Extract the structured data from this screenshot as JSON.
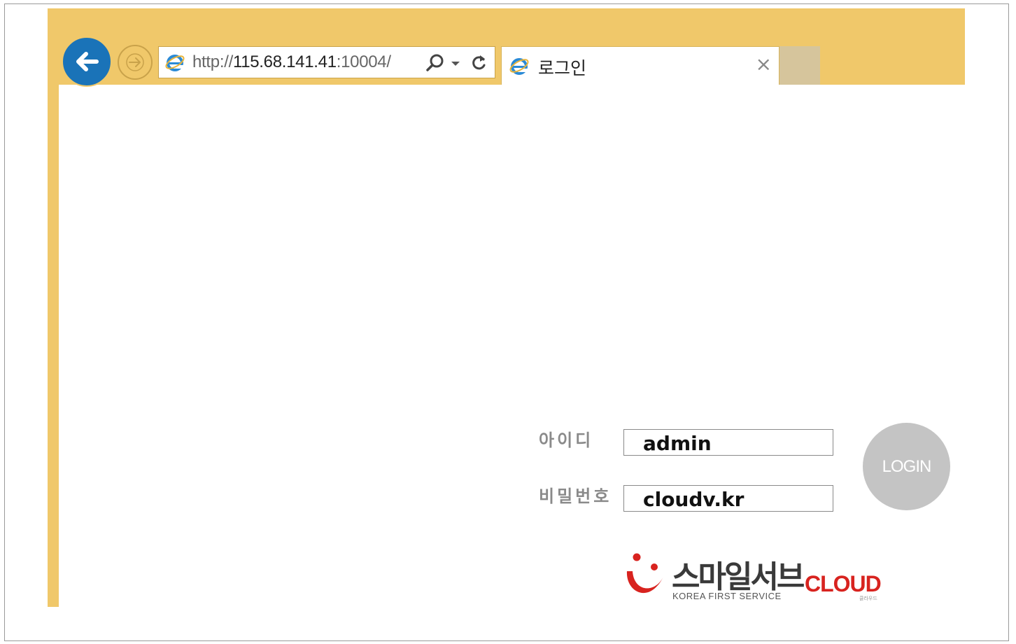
{
  "browser": {
    "address_bar": {
      "url_scheme": "http://",
      "url_host": "115.68.141.41",
      "url_rest": ":10004/"
    },
    "tab": {
      "title": "로그인",
      "close_glyph": "×"
    },
    "icons": [
      "back-arrow-icon",
      "forward-arrow-icon",
      "ie-icon",
      "search-icon",
      "dropdown-icon",
      "refresh-icon",
      "close-icon"
    ]
  },
  "login": {
    "id_label": "아이디",
    "id_value": "admin",
    "password_label": "비밀번호",
    "password_value": "cloudv.kr",
    "button_label": "LOGIN"
  },
  "logo": {
    "korean": "스마일서브",
    "english": "KOREA FIRST SERVICE",
    "cloud": "CLOUD",
    "cloud_sub": "클라우드"
  },
  "colors": {
    "browser_chrome": "#f0c86a",
    "back_button": "#1a73b8",
    "login_button": "#c4c4c4",
    "logo_red": "#d8231f"
  }
}
